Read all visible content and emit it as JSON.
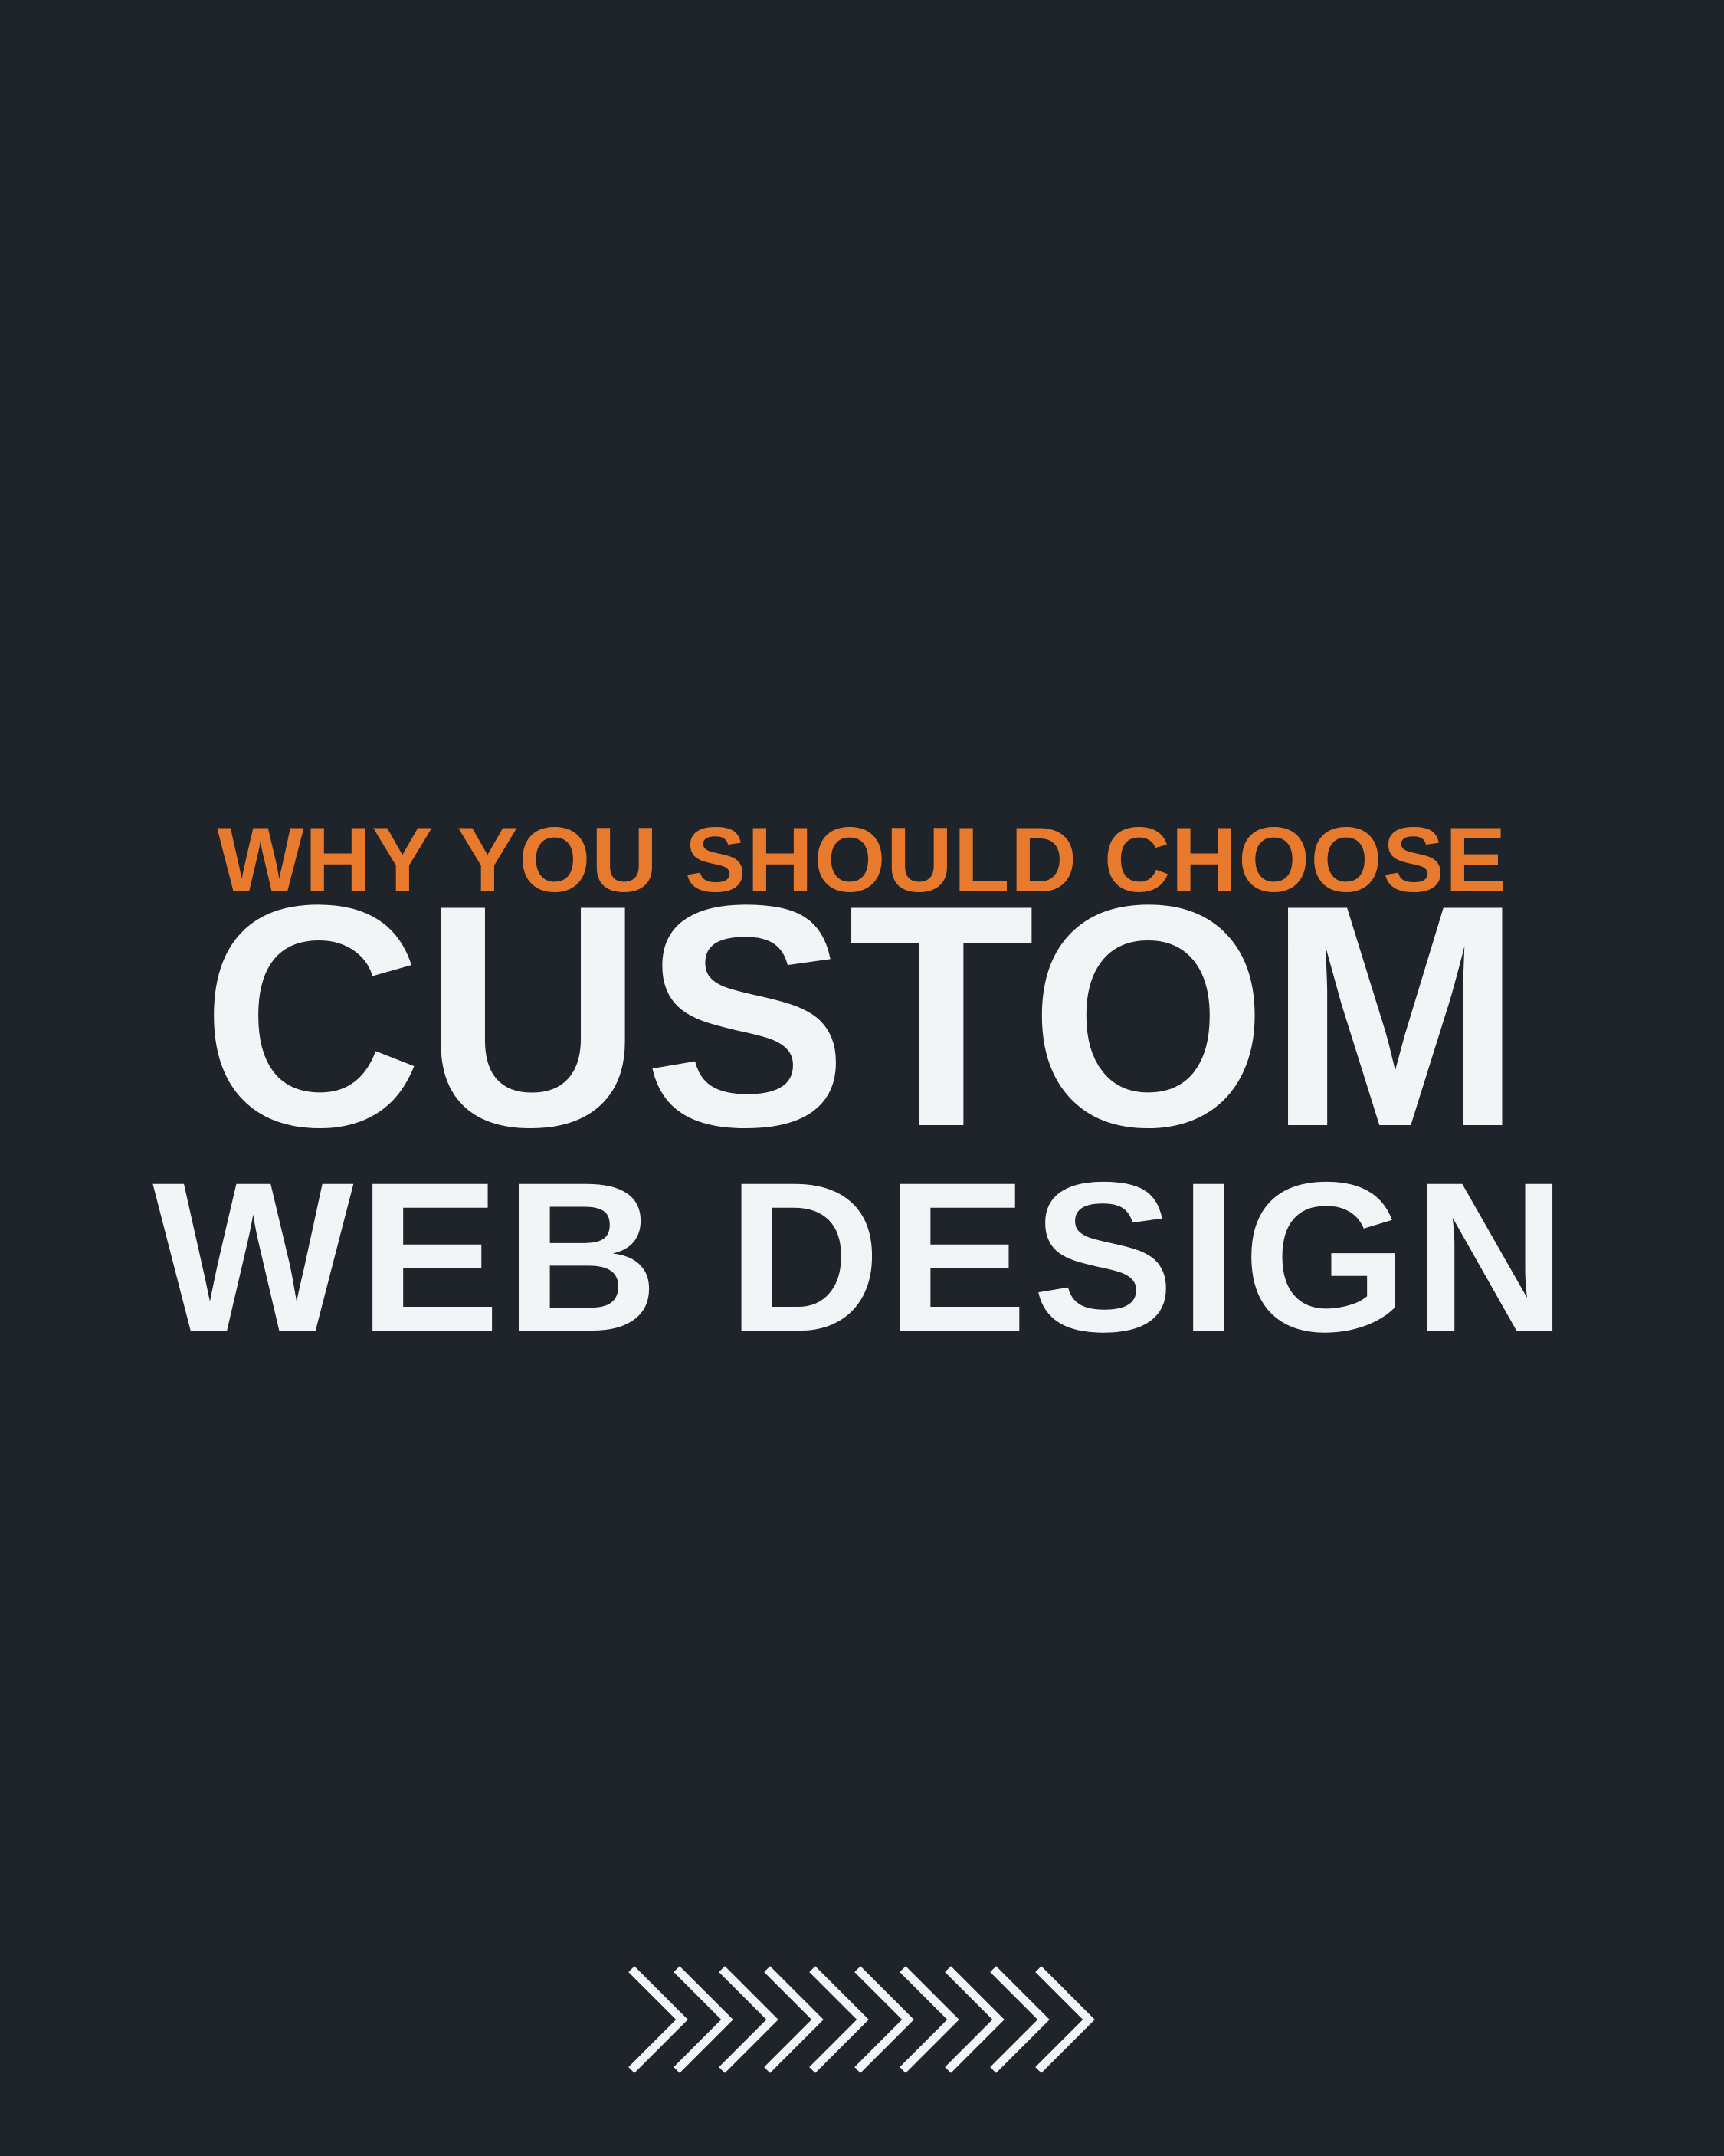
{
  "headline": {
    "kicker": "WHY YOU SHOULD CHOOSE",
    "line1": "CUSTOM",
    "line2": "WEB DESIGN"
  },
  "colors": {
    "background": "#1f242b",
    "accent": "#e87a2e",
    "text": "#f2f4f6"
  },
  "decoration": {
    "icon": "chevrons-right-icon",
    "count": 10
  }
}
